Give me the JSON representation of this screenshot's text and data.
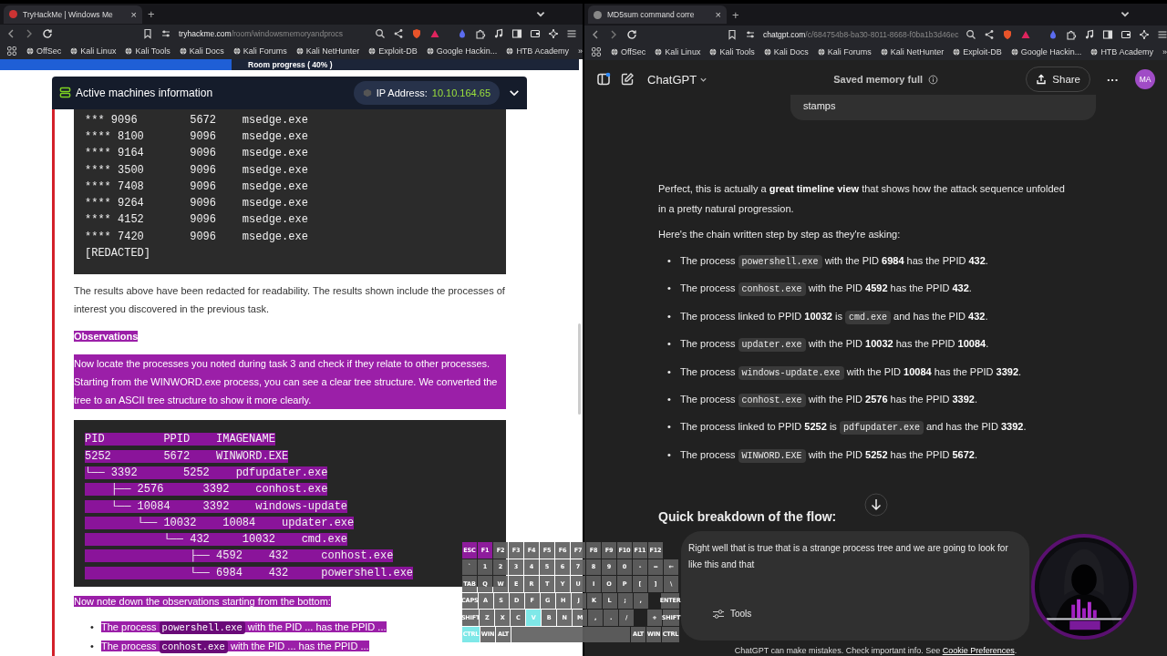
{
  "browsers": [
    {
      "kind": "tryhackme",
      "tab": {
        "title": "TryHackMe | Windows Me",
        "close": "×"
      },
      "new_tab": "+",
      "url": {
        "host": "tryhackme.com",
        "path": "/room/windowsmemoryandprocs"
      },
      "bookmarks": [
        "OffSec",
        "Kali Linux",
        "Kali Tools",
        "Kali Docs",
        "Kali Forums",
        "Kali NetHunter",
        "Exploit-DB",
        "Google Hackin...",
        "HTB Academy"
      ],
      "more": "»"
    },
    {
      "kind": "chatgpt",
      "tab": {
        "title": "MD5sum command corre",
        "close": "×"
      },
      "new_tab": "+",
      "url": {
        "host": "chatgpt.com",
        "path": "/c/684754b8-ba30-8011-8668-f0ba1b3d46ec"
      },
      "bookmarks": [
        "OffSec",
        "Kali Linux",
        "Kali Tools",
        "Kali Docs",
        "Kali Forums",
        "Kali NetHunter",
        "Exploit-DB",
        "Google Hackin...",
        "HTB Academy"
      ],
      "more": "»"
    }
  ],
  "tryhackme": {
    "progress": {
      "label": "Room progress ( 40% )",
      "level": 0.4
    },
    "machine_card": {
      "title": "Active machines information",
      "ip_label": "IP Address:",
      "ip": "10.10.164.65"
    },
    "code_block_1": [
      "*** 9096        5672    msedge.exe",
      "**** 8100       9096    msedge.exe",
      "**** 9164       9096    msedge.exe",
      "**** 3500       9096    msedge.exe",
      "**** 7408       9096    msedge.exe",
      "**** 9264       9096    msedge.exe",
      "**** 4152       9096    msedge.exe",
      "**** 7420       9096    msedge.exe",
      "[REDACTED]"
    ],
    "paragraph": "The results above have been redacted for readability. The results shown include the processes of interest you discovered in the previous task.",
    "heading": {
      "text": "Observations",
      "selected": true
    },
    "intro": {
      "text": "Now locate the processes you noted during task 3 and check if they relate to other processes. Starting from the WINWORD.exe process, you can see a clear tree structure. We converted the tree to an ASCII tree structure to show it more clearly.",
      "selected": true
    },
    "code_block_2": {
      "selected": true,
      "lines": [
        "PID         PPID    IMAGENAME",
        "5252        5672    WINWORD.EXE",
        "└── 3392       5252    pdfupdater.exe",
        "    ├── 2576      3392    conhost.exe",
        "    └── 10084     3392    windows-update",
        "        └── 10032    10084    updater.exe",
        "            └── 432     10032    cmd.exe",
        "                ├── 4592    432     conhost.exe",
        "                └── 6984    432     powershell.exe"
      ]
    },
    "note": {
      "text": "Now note down the observations starting from the bottom:",
      "selected": true
    },
    "bullets": [
      {
        "marker": "•",
        "selected": true,
        "before": "The process",
        "code": "powershell.exe",
        "after": "with the PID ... has the PPID ..."
      },
      {
        "marker": "•",
        "selected": true,
        "before": "The process",
        "code": "conhost.exe",
        "after": "with the PID ... has the PPID ..."
      }
    ]
  },
  "chatgpt": {
    "header": {
      "title": "ChatGPT",
      "memory": "Saved memory full",
      "share": "Share",
      "more": "···",
      "avatar": "MA"
    },
    "user_bubble": "stamps",
    "intro": "Perfect, this is actually a **great timeline view** that shows how the attack sequence unfolded in a pretty natural progression.",
    "lead": "Here's the chain written step by step as they're asking:",
    "bullet_marker": "•",
    "bullets": [
      [
        {
          "kind": "text",
          "text": "The process "
        },
        {
          "kind": "code",
          "text": "powershell.exe"
        },
        {
          "kind": "text",
          "text": " with the PID **6984** has the PPID **432**."
        }
      ],
      [
        {
          "kind": "text",
          "text": "The process "
        },
        {
          "kind": "code",
          "text": "conhost.exe"
        },
        {
          "kind": "text",
          "text": " with the PID **4592** has the PPID **432**."
        }
      ],
      [
        {
          "kind": "text",
          "text": "The process linked to PPID **10032** is "
        },
        {
          "kind": "code",
          "text": "cmd.exe"
        },
        {
          "kind": "text",
          "text": " and has the PID **432**."
        }
      ],
      [
        {
          "kind": "text",
          "text": "The process "
        },
        {
          "kind": "code",
          "text": "updater.exe"
        },
        {
          "kind": "text",
          "text": " with the PID **10032** has the PPID **10084**."
        }
      ],
      [
        {
          "kind": "text",
          "text": "The process "
        },
        {
          "kind": "code",
          "text": "windows-update.exe"
        },
        {
          "kind": "text",
          "text": " with the PID **10084** has the PPID **3392**."
        }
      ],
      [
        {
          "kind": "text",
          "text": "The process "
        },
        {
          "kind": "code",
          "text": "conhost.exe"
        },
        {
          "kind": "text",
          "text": " with the PID **2576** has the PPID **3392**."
        }
      ],
      [
        {
          "kind": "text",
          "text": "The process linked to PPID **5252** is "
        },
        {
          "kind": "code",
          "text": "pdfupdater.exe"
        },
        {
          "kind": "text",
          "text": " and has the PID **3392**."
        }
      ],
      [
        {
          "kind": "text",
          "text": "The process "
        },
        {
          "kind": "code",
          "text": "WINWORD.EXE"
        },
        {
          "kind": "text",
          "text": " with the PID **5252** has the PPID **5672**."
        }
      ]
    ],
    "section_heading": "Quick breakdown of the flow:",
    "composer": {
      "lines": [
        "Right well that is true that is a strange process tree and we are going to look for",
        "like this and that"
      ],
      "tools": "Tools"
    },
    "footer": {
      "text": "ChatGPT can make mistakes. Check important info. See",
      "link": "Cookie Preferences",
      "end": "."
    }
  },
  "keyboard": [
    [
      {
        "kind": "key",
        "label": "ESC",
        "color": "#8e1c9c"
      },
      {
        "kind": "key",
        "label": "F1",
        "color": "#8e1c9c"
      },
      {
        "kind": "key",
        "label": "F2"
      },
      {
        "kind": "key",
        "label": "F3"
      },
      {
        "kind": "key",
        "label": "F4"
      },
      {
        "kind": "key",
        "label": "F5"
      },
      {
        "kind": "key",
        "label": "F6"
      },
      {
        "kind": "key",
        "label": "F7"
      },
      {
        "kind": "key",
        "label": "F8"
      },
      {
        "kind": "key",
        "label": "F9"
      },
      {
        "kind": "key",
        "label": "F10"
      },
      {
        "kind": "key",
        "label": "F11"
      },
      {
        "kind": "key",
        "label": "F12"
      }
    ],
    [
      {
        "kind": "key",
        "label": "`"
      },
      {
        "kind": "key",
        "label": "1"
      },
      {
        "kind": "key",
        "label": "2"
      },
      {
        "kind": "key",
        "label": "3"
      },
      {
        "kind": "key",
        "label": "4"
      },
      {
        "kind": "key",
        "label": "5"
      },
      {
        "kind": "key",
        "label": "6"
      },
      {
        "kind": "key",
        "label": "7"
      },
      {
        "kind": "key",
        "label": "8"
      },
      {
        "kind": "key",
        "label": "9"
      },
      {
        "kind": "key",
        "label": "0"
      },
      {
        "kind": "key",
        "label": "-"
      },
      {
        "kind": "key",
        "label": "="
      },
      {
        "kind": "key",
        "label": "←"
      }
    ],
    [
      {
        "kind": "key",
        "label": "TAB"
      },
      {
        "kind": "key",
        "label": "Q"
      },
      {
        "kind": "key",
        "label": "W"
      },
      {
        "kind": "key",
        "label": "E"
      },
      {
        "kind": "key",
        "label": "R"
      },
      {
        "kind": "key",
        "label": "T"
      },
      {
        "kind": "key",
        "label": "Y"
      },
      {
        "kind": "key",
        "label": "U"
      },
      {
        "kind": "key",
        "label": "I"
      },
      {
        "kind": "key",
        "label": "O"
      },
      {
        "kind": "key",
        "label": "P"
      },
      {
        "kind": "key",
        "label": "["
      },
      {
        "kind": "key",
        "label": "]"
      },
      {
        "kind": "key",
        "label": "\\"
      }
    ],
    [
      {
        "kind": "key",
        "label": "CAPS"
      },
      {
        "kind": "key",
        "label": "A"
      },
      {
        "kind": "key",
        "label": "S"
      },
      {
        "kind": "key",
        "label": "D"
      },
      {
        "kind": "key",
        "label": "F"
      },
      {
        "kind": "key",
        "label": "G"
      },
      {
        "kind": "key",
        "label": "H"
      },
      {
        "kind": "key",
        "label": "J"
      },
      {
        "kind": "key",
        "label": "K"
      },
      {
        "kind": "key",
        "label": "L"
      },
      {
        "kind": "key",
        "label": ";"
      },
      {
        "kind": "key",
        "label": ","
      },
      {
        "kind": "gap"
      },
      {
        "kind": "key",
        "label": "ENTER"
      }
    ],
    [
      {
        "kind": "key",
        "label": "SHIFT"
      },
      {
        "kind": "key",
        "label": "Z"
      },
      {
        "kind": "key",
        "label": "X"
      },
      {
        "kind": "key",
        "label": "C"
      },
      {
        "kind": "key",
        "label": "V",
        "color": "#7fe8e8"
      },
      {
        "kind": "key",
        "label": "B"
      },
      {
        "kind": "key",
        "label": "N"
      },
      {
        "kind": "key",
        "label": "M"
      },
      {
        "kind": "key",
        "label": ","
      },
      {
        "kind": "key",
        "label": "."
      },
      {
        "kind": "key",
        "label": "/"
      },
      {
        "kind": "gap"
      },
      {
        "kind": "key",
        "label": "+"
      },
      {
        "kind": "key",
        "label": "SHIFT"
      }
    ],
    [
      {
        "kind": "key",
        "label": "CTRL",
        "color": "#7fe8e8"
      },
      {
        "kind": "key",
        "label": "WIN"
      },
      {
        "kind": "key",
        "label": "ALT"
      },
      {
        "kind": "space"
      },
      {
        "kind": "key",
        "label": "ALT"
      },
      {
        "kind": "key",
        "label": "WIN"
      },
      {
        "kind": "key",
        "label": "CTRL"
      }
    ]
  ]
}
